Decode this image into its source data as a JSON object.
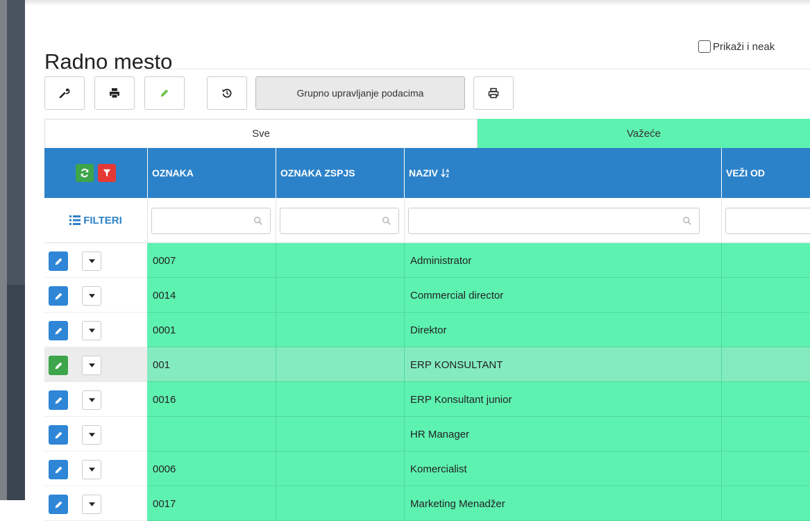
{
  "page": {
    "title": "Radno mesto",
    "show_inactive_label": "Prikaži i neak"
  },
  "toolbar": {
    "group_manage_label": "Grupno upravljanje podacima",
    "icons": [
      "wrench-icon",
      "print-icon",
      "pencil-icon",
      "history-icon",
      "print-icon"
    ]
  },
  "tabs": [
    {
      "label": "Sve",
      "active": false
    },
    {
      "label": "Važeće",
      "active": true
    }
  ],
  "table": {
    "columns": [
      "OZNAKA",
      "OZNAKA ZSPJS",
      "NAZIV",
      "VEŽI OD"
    ],
    "sort_column": "NAZIV",
    "filters_label": "FILTERI",
    "rows": [
      {
        "oznaka": "0007",
        "oznaka_zspjs": "",
        "naziv": "Administrator",
        "vazi_od": ""
      },
      {
        "oznaka": "0014",
        "oznaka_zspjs": "",
        "naziv": "Commercial director",
        "vazi_od": ""
      },
      {
        "oznaka": "0001",
        "oznaka_zspjs": "",
        "naziv": "Direktor",
        "vazi_od": ""
      },
      {
        "oznaka": "001",
        "oznaka_zspjs": "",
        "naziv": "ERP KONSULTANT",
        "vazi_od": ""
      },
      {
        "oznaka": "0016",
        "oznaka_zspjs": "",
        "naziv": "ERP Konsultant junior",
        "vazi_od": ""
      },
      {
        "oznaka": "",
        "oznaka_zspjs": "",
        "naziv": "HR Manager",
        "vazi_od": ""
      },
      {
        "oznaka": "0006",
        "oznaka_zspjs": "",
        "naziv": "Komercialist",
        "vazi_od": ""
      },
      {
        "oznaka": "0017",
        "oznaka_zspjs": "",
        "naziv": "Marketing Menadžer",
        "vazi_od": ""
      }
    ],
    "selected_row": 3
  },
  "colors": {
    "header_blue": "#2c82c9",
    "row_green": "#5ef2b1",
    "row_selected": "#84ebc0",
    "edit_blue": "#2f86d6",
    "edit_green": "#3da54a",
    "filter_red": "#e53935"
  }
}
